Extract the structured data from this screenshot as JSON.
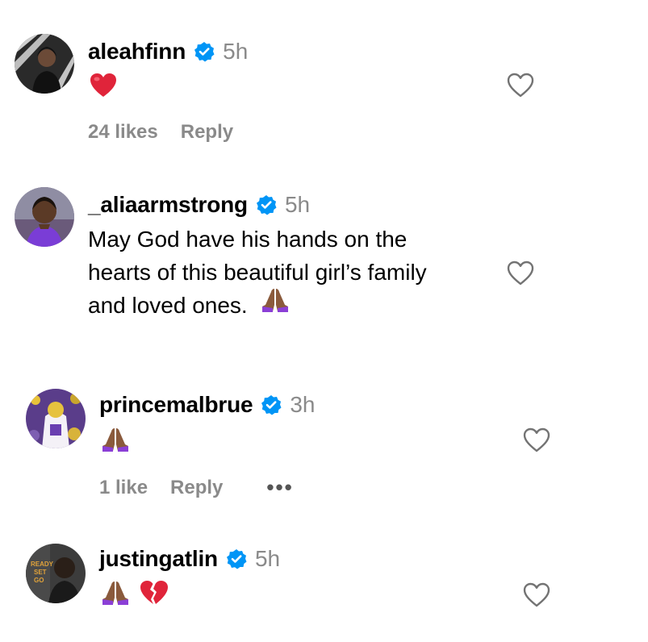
{
  "comments": [
    {
      "username": "aleahfinn",
      "time": "5h",
      "text_emojis": [
        "red-heart"
      ],
      "likes": "24 likes",
      "reply": "Reply"
    },
    {
      "username": "_aliaarmstrong",
      "time": "5h",
      "text_lines": [
        "May God have his hands on the",
        "hearts of this beautiful girl’s family",
        "and loved ones."
      ],
      "text_emojis": [
        "folded-hands"
      ]
    },
    {
      "username": "princemalbrue",
      "time": "3h",
      "text_emojis": [
        "folded-hands"
      ],
      "likes": "1 like",
      "reply": "Reply",
      "more": "•••"
    },
    {
      "username": "justingatlin",
      "time": "5h",
      "text_emojis": [
        "folded-hands",
        "broken-heart"
      ]
    }
  ],
  "colors": {
    "verified": "#0095f6",
    "muted": "#8a8a8a",
    "heart": "#e0243a"
  },
  "avatar_1_text": [
    "READY",
    "SET",
    "GO"
  ]
}
